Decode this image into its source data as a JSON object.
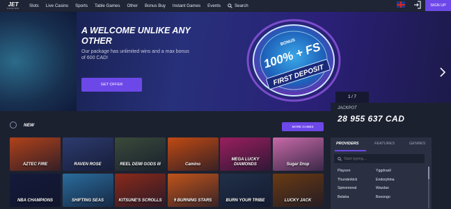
{
  "header": {
    "logo_text": "JET",
    "logo_sub": "CASINO",
    "nav": [
      "Slots",
      "Live Casino",
      "Sports",
      "Table Games",
      "Other",
      "Bonus Buy",
      "Instant Games",
      "Events"
    ],
    "search_label": "Search",
    "signup_label": "SIGN UP"
  },
  "hero": {
    "title": "A WELCOME UNLIKE ANY OTHER",
    "subtitle": "Our package has unlimited wins and a max bonus of 600 CAD!",
    "cta_label": "GET OFFER",
    "disc_bonus": "BONUS",
    "disc_main": "100% + FS",
    "disc_ribbon": "FIRST DEPOSIT",
    "counter": "1 / 7"
  },
  "new_section": {
    "title": "NEW",
    "more_label": "MORE GAMES",
    "games": [
      {
        "name": "AZTEC FIRE",
        "color": "#b0421a"
      },
      {
        "name": "RAVEN ROSE",
        "color": "#2d3b6e"
      },
      {
        "name": "REEL DEMI GODS III",
        "color": "#3a4a3a"
      },
      {
        "name": "Camino",
        "color": "#c04a12"
      },
      {
        "name": "MEGA LUCKY DIAMONDS",
        "color": "#9a1f5e"
      },
      {
        "name": "Sugar Drop",
        "color": "#c86aa8"
      },
      {
        "name": "NBA CHAMPIONS",
        "color": "#141a3a"
      },
      {
        "name": "SHIFTING SEAS",
        "color": "#2a6c9c"
      },
      {
        "name": "KITSUNE'S SCROLLS",
        "color": "#8a2a1a"
      },
      {
        "name": "9 BURNING STARS",
        "color": "#c0541a"
      },
      {
        "name": "BURN YOUR TRIBE",
        "color": "#203048"
      },
      {
        "name": "LUCKY JACK",
        "color": "#6a3a12"
      }
    ]
  },
  "jackpot": {
    "label": "JACKPOT",
    "amount": "28 955 637 CAD"
  },
  "providers": {
    "tabs": [
      "PROVIDERS",
      "FEATURES",
      "GENRES"
    ],
    "search_placeholder": "Start typing...",
    "rows": [
      [
        "Playson",
        "Yggdrasil"
      ],
      [
        "Thunderkick",
        "Endorphina"
      ],
      [
        "Spinomenal",
        "Wazdan"
      ],
      [
        "Belatra",
        "Booongo"
      ]
    ]
  },
  "colors": {
    "accent": "#6d48e8",
    "background": "#1c2130",
    "panel": "#2a3042"
  }
}
